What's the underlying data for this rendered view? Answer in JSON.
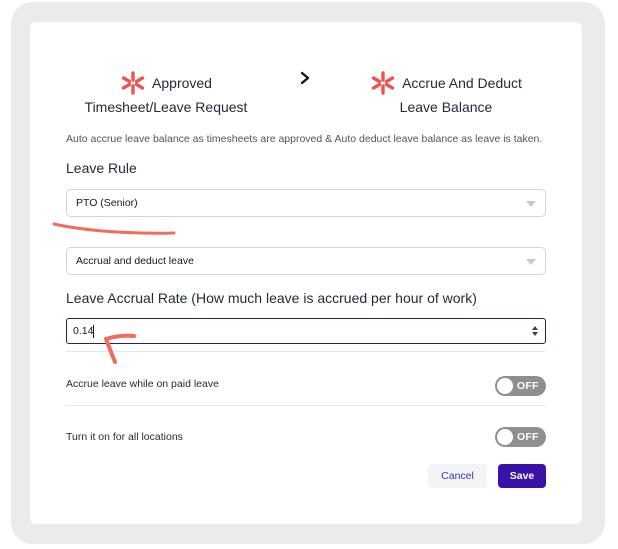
{
  "steps": {
    "left": {
      "line1": "Approved",
      "line2": "Timesheet/Leave Request",
      "icon": "brand-logo-icon"
    },
    "right": {
      "line1": "Accrue And Deduct",
      "line2": "Leave Balance",
      "icon": "brand-logo-icon"
    },
    "separator_icon": "chevron-right-icon"
  },
  "description": "Auto accrue leave balance as timesheets are approved & Auto deduct leave balance as leave is taken.",
  "leave_rule": {
    "label": "Leave Rule",
    "selected": "PTO (Senior)"
  },
  "mode": {
    "selected": "Accrual and deduct leave"
  },
  "accrual_rate": {
    "label": "Leave Accrual Rate (How much leave is accrued per hour of work)",
    "value": "0.14"
  },
  "toggles": [
    {
      "label": "Accrue leave while on paid leave",
      "state": "OFF"
    },
    {
      "label": "Turn it on for all locations",
      "state": "OFF"
    }
  ],
  "buttons": {
    "cancel": "Cancel",
    "save": "Save"
  },
  "colors": {
    "brand_icon": "#ef5350",
    "primary": "#3b12a8",
    "annotation": "#f26b5b",
    "toggle_off": "#8e8e93"
  }
}
